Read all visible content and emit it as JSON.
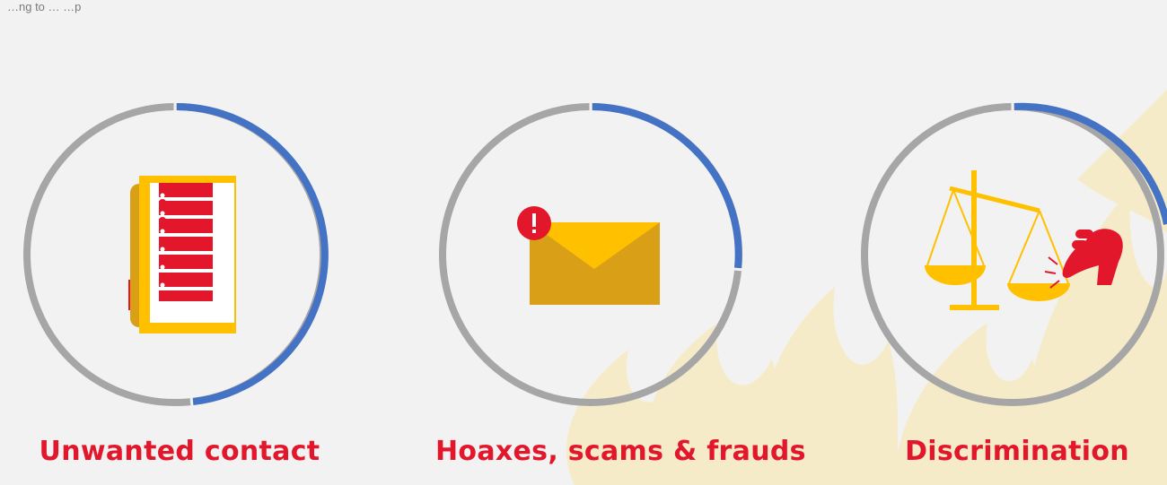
{
  "header": {
    "top_text": "…ng to … …p"
  },
  "colors": {
    "ring_gray": "#a6a6a6",
    "ring_blue": "#4472c4",
    "label_red": "#e2172b",
    "icon_yellow": "#ffc000",
    "icon_dark_yellow": "#d9a017",
    "flame_background": "#f6ebc8"
  },
  "cards": [
    {
      "label": "Unwanted contact",
      "icon": "notepad-list-icon",
      "progress_fraction": 0.48
    },
    {
      "label": "Hoaxes, scams & frauds",
      "icon": "envelope-alert-icon",
      "progress_fraction": 0.27
    },
    {
      "label": "Discrimination",
      "icon": "scales-pointing-hand-icon",
      "progress_fraction": 0.3
    }
  ]
}
